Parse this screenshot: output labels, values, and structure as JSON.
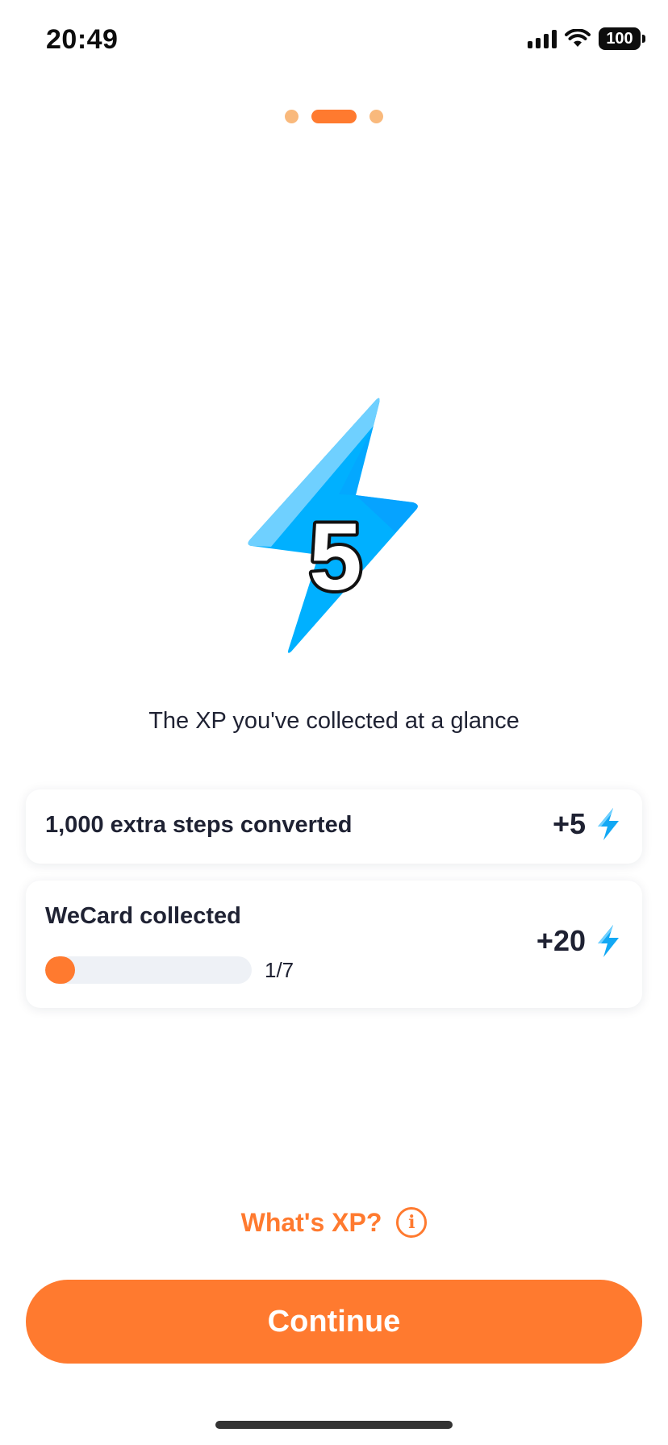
{
  "status_bar": {
    "time": "20:49",
    "battery": "100",
    "icons": [
      "cellular-signal-icon",
      "wifi-icon",
      "battery-icon"
    ]
  },
  "pager": {
    "total": 3,
    "active_index": 1
  },
  "hero": {
    "icon": "lightning-bolt-icon",
    "value": "5"
  },
  "subtitle": "The XP you've collected at a glance",
  "rewards": [
    {
      "label": "1,000 extra steps converted",
      "value": "+5",
      "icon": "lightning-bolt-icon"
    },
    {
      "label": "WeCard collected",
      "value": "+20",
      "icon": "lightning-bolt-icon",
      "progress": {
        "text": "1/7",
        "fraction": 0.142857
      }
    }
  ],
  "whats_xp": {
    "label": "What's XP?",
    "icon": "info-icon",
    "icon_glyph": "i"
  },
  "continue_label": "Continue",
  "colors": {
    "accent": "#ff7a2f",
    "accent_light": "#f9b97c",
    "bolt_blue": "#00b0ff",
    "bolt_light": "#6fd0ff",
    "text_dark": "#1f2233",
    "track": "#eef1f6"
  }
}
